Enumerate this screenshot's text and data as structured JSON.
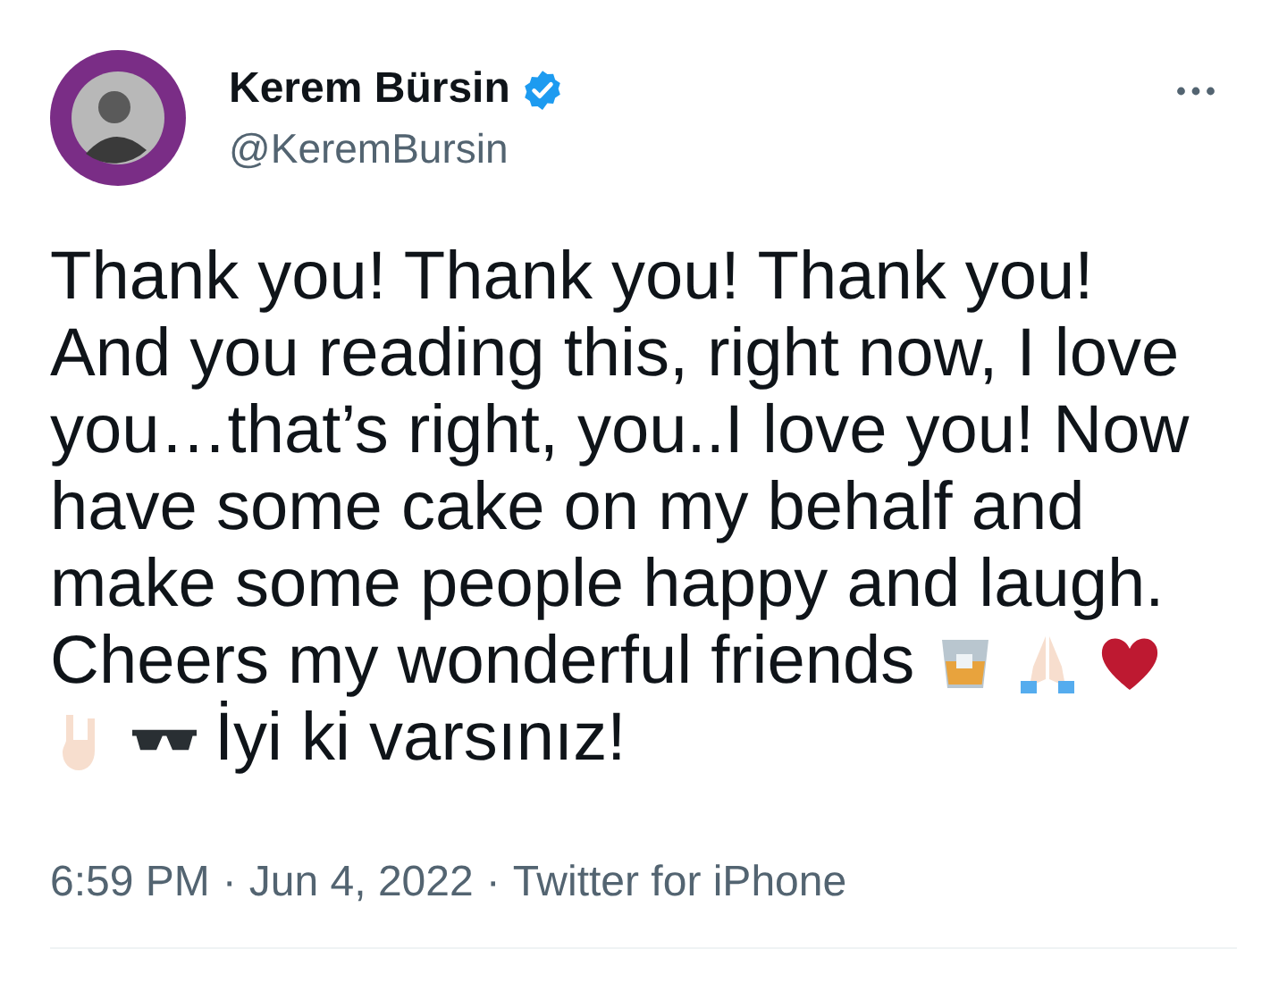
{
  "author": {
    "name": "Kerem Bürsin",
    "verified": true,
    "handle": "@KeremBursin"
  },
  "body_lines": [
    [
      {
        "kind": "text",
        "text": "Thank you! Thank you! Thank you!"
      }
    ],
    [
      {
        "kind": "text",
        "text": "And you reading this, right now, I love"
      }
    ],
    [
      {
        "kind": "text",
        "text": "you…that’s right, you..I love you! Now"
      }
    ],
    [
      {
        "kind": "text",
        "text": "have some cake on my behalf and"
      }
    ],
    [
      {
        "kind": "text",
        "text": "make some people happy and laugh."
      }
    ],
    [
      {
        "kind": "text",
        "text": "Cheers my wonderful friends"
      },
      {
        "kind": "glass"
      },
      {
        "kind": "hands"
      },
      {
        "kind": "heart"
      }
    ],
    [
      {
        "kind": "horns"
      },
      {
        "kind": "sunglasses"
      },
      {
        "kind": "text",
        "text": "İyi ki varsınız!"
      }
    ]
  ],
  "meta": {
    "time": "6:59 PM",
    "separator_1": "·",
    "date": "Jun 4, 2022",
    "separator_2": "·",
    "source": "Twitter for iPhone"
  }
}
